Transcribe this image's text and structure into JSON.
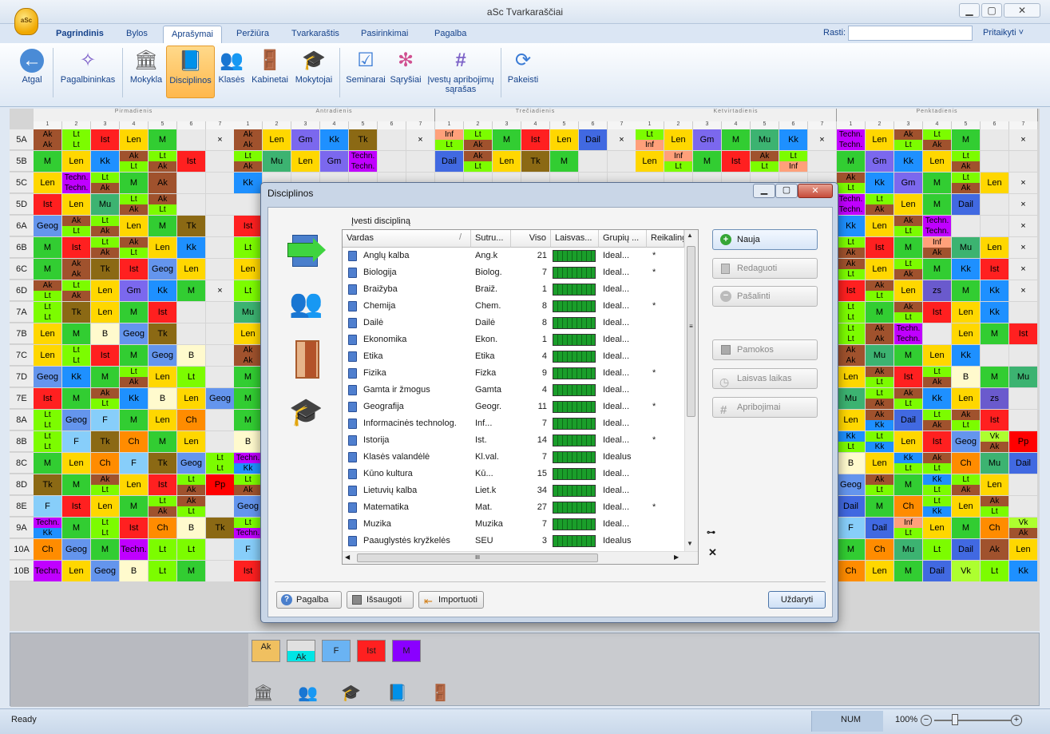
{
  "app": {
    "title": "aSc Tvarkaraščiai",
    "logo_text": "aSc"
  },
  "window_controls": {
    "minimize": "▁",
    "maximize": "▢",
    "close": "✕"
  },
  "menu_tabs": [
    "Pagrindinis",
    "Bylos",
    "Aprašymai",
    "Peržiūra",
    "Tvarkaraštis",
    "Pasirinkimai",
    "Pagalba"
  ],
  "active_tab": "Aprašymai",
  "search": {
    "label": "Rasti:",
    "value": ""
  },
  "customize": "Pritaikyti ˅",
  "ribbon": [
    {
      "label": "Atgal",
      "icon": "back-arrow-icon",
      "glyph": "←"
    },
    {
      "label": "Pagalbininkas",
      "icon": "magic-wand-icon",
      "glyph": "✧"
    },
    {
      "label": "Mokykla",
      "icon": "school-building-icon",
      "glyph": "🏛"
    },
    {
      "label": "Disciplinos",
      "icon": "book-icon",
      "glyph": "📘"
    },
    {
      "label": "Klasės",
      "icon": "students-icon",
      "glyph": "👥"
    },
    {
      "label": "Kabinetai",
      "icon": "door-icon",
      "glyph": "🚪"
    },
    {
      "label": "Mokytojai",
      "icon": "graduation-cap-icon",
      "glyph": "🎓"
    },
    {
      "label": "Seminarai",
      "icon": "seminar-icon",
      "glyph": "☑"
    },
    {
      "label": "Sąryšiai",
      "icon": "relations-icon",
      "glyph": "✻"
    },
    {
      "label": "Įvestų apribojimų sąrašas",
      "icon": "constraints-grid-icon",
      "glyph": "#"
    },
    {
      "label": "Pakeisti",
      "icon": "swap-person-icon",
      "glyph": "⟳"
    }
  ],
  "days": [
    "Pirmadienis",
    "Antradienis",
    "Trečiadienis",
    "Ketvirtadienis",
    "Penktadienis"
  ],
  "periods": [
    "1",
    "2",
    "3",
    "4",
    "5",
    "6",
    "7"
  ],
  "classes": [
    "5A",
    "5B",
    "5C",
    "5D",
    "6A",
    "6B",
    "6C",
    "6D",
    "7A",
    "7B",
    "7C",
    "7D",
    "7E",
    "8A",
    "8B",
    "8C",
    "8D",
    "8E",
    "9A",
    "10A",
    "10B"
  ],
  "timetable": {
    "5A": [
      [
        "Ak|Ak",
        "Lt|Lt",
        "Ist",
        "Len",
        "M",
        "",
        "×"
      ],
      [
        "Ak|Ak",
        "Len",
        "Gm",
        "Kk",
        "Tk",
        "",
        "×"
      ],
      [
        "Inf|Lt",
        "Lt|Ak",
        "M",
        "Ist",
        "Len",
        "Dail",
        "×"
      ],
      [
        "Lt|Inf",
        "Len",
        "Gm",
        "M",
        "Mu",
        "Kk",
        "×"
      ],
      [
        "Techn.|Techn.",
        "Len",
        "Ak|Lt",
        "Lt|Ak",
        "M",
        "",
        "×"
      ]
    ],
    "5B": [
      [
        "M",
        "Len",
        "Kk",
        "Ak|Lt",
        "Lt|Ak",
        "Ist",
        ""
      ],
      [
        "Lt|Ak",
        "Mu",
        "Len",
        "Gm",
        "Techn.|Techn.",
        "",
        ""
      ],
      [
        "Dail",
        "Ak|Lt",
        "Len",
        "Tk",
        "M",
        "",
        ""
      ],
      [
        "Len",
        "Inf|Lt",
        "M",
        "Ist",
        "Ak|Lt",
        "Lt|Inf",
        ""
      ],
      [
        "M",
        "Gm",
        "Kk",
        "Len",
        "Lt|Ak",
        "",
        ""
      ]
    ],
    "5C": [
      [
        "Len",
        "Techn.|Techn.",
        "Lt|Ak",
        "M",
        "Ak",
        "",
        ""
      ],
      [
        "Kk",
        "",
        "",
        "",
        "",
        "",
        ""
      ],
      [
        "",
        "",
        "",
        "",
        "",
        "",
        ""
      ],
      [
        "",
        "",
        "",
        "",
        "",
        "",
        ""
      ],
      [
        "Ak|Lt",
        "Kk",
        "Gm",
        "M",
        "Lt|Ak",
        "Len",
        "×"
      ]
    ],
    "5D": [
      [
        "Ist",
        "Len",
        "Mu",
        "Lt|Ak",
        "Ak|Lt",
        "",
        ""
      ],
      [
        "",
        "",
        "",
        "",
        "",
        "",
        ""
      ],
      [
        "",
        "",
        "",
        "",
        "",
        "",
        ""
      ],
      [
        "",
        "",
        "",
        "",
        "",
        "",
        ""
      ],
      [
        "Techn.|Techn.",
        "Lt|Ak",
        "Len",
        "M",
        "Dail",
        "",
        "×"
      ]
    ],
    "6A": [
      [
        "Geog",
        "Ak|Lt",
        "Lt|Ak",
        "Len",
        "M",
        "Tk",
        ""
      ],
      [
        "Ist",
        "",
        "",
        "",
        "",
        "",
        ""
      ],
      [
        "",
        "",
        "",
        "",
        "",
        "",
        ""
      ],
      [
        "",
        "",
        "",
        "",
        "",
        "",
        ""
      ],
      [
        "Kk",
        "Len",
        "Ak|Lt",
        "Techn.|Techn.",
        "",
        "",
        "×"
      ]
    ],
    "6B": [
      [
        "M",
        "Ist",
        "Lt|Ak",
        "Ak|Lt",
        "Len",
        "Kk",
        ""
      ],
      [
        "Lt",
        "",
        "",
        "",
        "",
        "",
        ""
      ],
      [
        "",
        "",
        "",
        "",
        "",
        "",
        ""
      ],
      [
        "",
        "",
        "",
        "",
        "",
        "",
        ""
      ],
      [
        "Lt|Ak",
        "Ist",
        "M",
        "Inf|Ak",
        "Mu",
        "Len",
        "×"
      ]
    ],
    "6C": [
      [
        "M",
        "Ak|Ak",
        "Tk",
        "Ist",
        "Geog",
        "Len",
        ""
      ],
      [
        "Len",
        "",
        "",
        "",
        "",
        "",
        ""
      ],
      [
        "",
        "",
        "",
        "",
        "",
        "",
        ""
      ],
      [
        "",
        "",
        "",
        "",
        "",
        "",
        ""
      ],
      [
        "Ak|Lt",
        "Len",
        "Lt|Ak",
        "M",
        "Kk",
        "Ist",
        "×"
      ]
    ],
    "6D": [
      [
        "Ak|Lt",
        "Lt|Ak",
        "Len",
        "Gm",
        "Kk",
        "M",
        "×"
      ],
      [
        "Lt",
        "",
        "",
        "",
        "",
        "",
        ""
      ],
      [
        "",
        "",
        "",
        "",
        "",
        "",
        ""
      ],
      [
        "",
        "",
        "",
        "",
        "",
        "",
        ""
      ],
      [
        "Ist",
        "Ak|Lt",
        "Len",
        "zs",
        "M",
        "Kk",
        "×"
      ]
    ],
    "7A": [
      [
        "Lt|Lt",
        "Tk",
        "Len",
        "M",
        "Ist",
        "",
        ""
      ],
      [
        "Mu",
        "",
        "",
        "",
        "",
        "",
        ""
      ],
      [
        "",
        "",
        "",
        "",
        "",
        "",
        ""
      ],
      [
        "",
        "",
        "",
        "",
        "",
        "",
        ""
      ],
      [
        "Lt|Lt",
        "M",
        "Ak|Lt",
        "Ist",
        "Len",
        "Kk",
        ""
      ]
    ],
    "7B": [
      [
        "Len",
        "M",
        "B",
        "Geog",
        "Tk",
        "",
        ""
      ],
      [
        "Len",
        "",
        "",
        "",
        "",
        "",
        ""
      ],
      [
        "",
        "",
        "",
        "",
        "",
        "",
        ""
      ],
      [
        "",
        "",
        "",
        "",
        "",
        "",
        ""
      ],
      [
        "Lt|Lt",
        "Ak|Ak",
        "Techn.|Techn.",
        "",
        "Len",
        "M",
        "Ist"
      ]
    ],
    "7C": [
      [
        "Len",
        "Lt|Lt",
        "Ist",
        "M",
        "Geog",
        "B",
        ""
      ],
      [
        "Ak|Ak",
        "",
        "",
        "",
        "",
        "",
        ""
      ],
      [
        "",
        "",
        "",
        "",
        "",
        "",
        ""
      ],
      [
        "",
        "",
        "",
        "",
        "",
        "",
        ""
      ],
      [
        "Ak|Ak",
        "Mu",
        "M",
        "Len",
        "Kk",
        "",
        ""
      ]
    ],
    "7D": [
      [
        "Geog",
        "Kk",
        "M",
        "Lt|Ak",
        "Len",
        "Lt",
        ""
      ],
      [
        "M",
        "",
        "",
        "",
        "",
        "",
        ""
      ],
      [
        "",
        "",
        "",
        "",
        "",
        "",
        ""
      ],
      [
        "",
        "",
        "",
        "",
        "",
        "",
        ""
      ],
      [
        "Len",
        "Ak|Lt",
        "Ist",
        "Lt|Ak",
        "B",
        "M",
        "Mu"
      ]
    ],
    "7E": [
      [
        "Ist",
        "M",
        "Ak|Lt",
        "Kk",
        "B",
        "Len",
        "Geog"
      ],
      [
        "M",
        "",
        "",
        "",
        "",
        "",
        ""
      ],
      [
        "",
        "",
        "",
        "",
        "",
        "",
        ""
      ],
      [
        "",
        "",
        "",
        "",
        "",
        "",
        ""
      ],
      [
        "Mu",
        "Lt|Ak",
        "Ak|Lt",
        "Kk",
        "Len",
        "zs",
        ""
      ]
    ],
    "8A": [
      [
        "Lt|Lt",
        "Geog",
        "F",
        "M",
        "Len",
        "Ch",
        ""
      ],
      [
        "M",
        "",
        "",
        "",
        "",
        "",
        ""
      ],
      [
        "",
        "",
        "",
        "",
        "",
        "",
        ""
      ],
      [
        "",
        "",
        "",
        "",
        "",
        "",
        ""
      ],
      [
        "Len",
        "Ak|Kk",
        "Dail",
        "Lt|Ak",
        "Ak|Lt",
        "Ist",
        ""
      ]
    ],
    "8B": [
      [
        "Lt|Lt",
        "F",
        "Tk",
        "Ch",
        "M",
        "Len",
        ""
      ],
      [
        "B",
        "",
        "",
        "",
        "",
        "",
        ""
      ],
      [
        "",
        "",
        "",
        "",
        "",
        "",
        ""
      ],
      [
        "",
        "",
        "",
        "",
        "",
        "",
        ""
      ],
      [
        "Kk|Lt",
        "Lt|Kk",
        "Len",
        "Ist",
        "Geog",
        "Vk|Ak",
        "Pp"
      ]
    ],
    "8C": [
      [
        "M",
        "Len",
        "Ch",
        "F",
        "Tk",
        "Geog",
        "Lt|Lt"
      ],
      [
        "Techn.|Kk",
        "",
        "",
        "",
        "",
        "",
        ""
      ],
      [
        "",
        "",
        "",
        "",
        "",
        "",
        ""
      ],
      [
        "",
        "",
        "",
        "",
        "",
        "",
        ""
      ],
      [
        "B",
        "Len",
        "Kk|Lt",
        "Ak|Lt",
        "Ch",
        "Mu",
        "Dail"
      ]
    ],
    "8D": [
      [
        "Tk",
        "M",
        "Ak|Lt",
        "Len",
        "Ist",
        "Lt|Ak",
        "Pp"
      ],
      [
        "Lt|Ak",
        "",
        "",
        "",
        "",
        "",
        ""
      ],
      [
        "",
        "",
        "",
        "",
        "",
        "",
        ""
      ],
      [
        "",
        "",
        "",
        "",
        "",
        "",
        ""
      ],
      [
        "Geog",
        "Ak|Lt",
        "M",
        "Kk|Lt",
        "Lt|Ak",
        "Len",
        ""
      ]
    ],
    "8E": [
      [
        "F",
        "Ist",
        "Len",
        "M",
        "Lt|Ak",
        "Ak|Lt",
        ""
      ],
      [
        "Geog",
        "",
        "",
        "",
        "",
        "",
        ""
      ],
      [
        "",
        "",
        "",
        "",
        "",
        "",
        ""
      ],
      [
        "",
        "",
        "",
        "",
        "",
        "",
        ""
      ],
      [
        "Dail",
        "M",
        "Ch",
        "Lt|Kk",
        "Len",
        "Ak|Lt",
        ""
      ]
    ],
    "9A": [
      [
        "Techn.|Kk",
        "M",
        "Lt|Lt",
        "Ist",
        "Ch",
        "B",
        "Tk"
      ],
      [
        "Lt|Techn.",
        "",
        "",
        "",
        "",
        "",
        ""
      ],
      [
        "",
        "",
        "",
        "",
        "",
        "",
        ""
      ],
      [
        "",
        "",
        "",
        "",
        "",
        "",
        ""
      ],
      [
        "F",
        "Dail",
        "Inf|Lt",
        "Len",
        "M",
        "Ch",
        "Vk|Ak"
      ]
    ],
    "10A": [
      [
        "Ch",
        "Geog",
        "M",
        "Techn.",
        "Lt",
        "Lt",
        ""
      ],
      [
        "F",
        "",
        "",
        "",
        "",
        "",
        ""
      ],
      [
        "",
        "",
        "",
        "",
        "",
        "",
        ""
      ],
      [
        "",
        "",
        "",
        "",
        "",
        "",
        ""
      ],
      [
        "M",
        "Ch",
        "Mu",
        "Lt",
        "Dail",
        "Ak",
        "Len"
      ]
    ],
    "10B": [
      [
        "Techn.",
        "Len",
        "Geog",
        "B",
        "Lt",
        "M",
        ""
      ],
      [
        "Ist",
        "",
        "",
        "",
        "",
        "",
        ""
      ],
      [
        "",
        "",
        "",
        "",
        "",
        "",
        ""
      ],
      [
        "",
        "",
        "",
        "",
        "",
        "",
        ""
      ],
      [
        "Ch",
        "Len",
        "M",
        "Dail",
        "Vk",
        "Lt",
        "Kk"
      ]
    ]
  },
  "subject_colors": {
    "Ak": "#a0522d",
    "Lt": "#7cfc00",
    "Ist": "#ff2020",
    "Len": "#ffd700",
    "M": "#32cd32",
    "Gm": "#7b68ee",
    "Kk": "#1e90ff",
    "Tk": "#8b6914",
    "Inf": "#ffa07a",
    "Dail": "#4169e1",
    "Mu": "#3cb371",
    "Techn.": "#c000ff",
    "Geog": "#6495ed",
    "B": "#fffacd",
    "F": "#87cefa",
    "Ch": "#ff8c00",
    "Pp": "#ff0000",
    "Vk": "#adff2f",
    "zs": "#6a5acd",
    "×": "#ececec",
    "": "#e9e9e9"
  },
  "bottom_cards": [
    [
      "Ak",
      "#f0c060"
    ],
    [
      "Ak",
      "#00e5e5"
    ],
    [
      "F",
      "#6ab3f3"
    ],
    [
      "Ist",
      "#ff2020"
    ],
    [
      "M",
      "#8a00ff"
    ]
  ],
  "bottom_icons": [
    "school-building-icon",
    "students-icon",
    "graduation-cap-icon",
    "book-icon",
    "door-icon"
  ],
  "dialog": {
    "title": "Disciplinos",
    "list_caption": "Įvesti discipliną",
    "columns": [
      "Vardas",
      "Sutru...",
      "Viso",
      "Laisvas...",
      "Grupių ...",
      "Reikaling"
    ],
    "rows": [
      [
        "Anglų kalba",
        "Ang.k",
        "21",
        "Ideal...",
        "*"
      ],
      [
        "Biologija",
        "Biolog.",
        "7",
        "Ideal...",
        "*"
      ],
      [
        "Braižyba",
        "Braiž.",
        "1",
        "Ideal...",
        ""
      ],
      [
        "Chemija",
        "Chem.",
        "8",
        "Ideal...",
        "*"
      ],
      [
        "Dailė",
        "Dailė",
        "8",
        "Ideal...",
        ""
      ],
      [
        "Ekonomika",
        "Ekon.",
        "1",
        "Ideal...",
        ""
      ],
      [
        "Etika",
        "Etika",
        "4",
        "Ideal...",
        ""
      ],
      [
        "Fizika",
        "Fizka",
        "9",
        "Ideal...",
        "*"
      ],
      [
        "Gamta ir žmogus",
        "Gamta",
        "4",
        "Ideal...",
        ""
      ],
      [
        "Geografija",
        "Geogr.",
        "11",
        "Ideal...",
        "*"
      ],
      [
        "Informacinės technolog.",
        "Inf...",
        "7",
        "Ideal...",
        ""
      ],
      [
        "Istorija",
        "Ist.",
        "14",
        "Ideal...",
        "*"
      ],
      [
        "Klasės valandėlė",
        "Kl.val.",
        "7",
        "Idealus",
        ""
      ],
      [
        "Kūno kultura",
        "Kū...",
        "15",
        "Ideal...",
        ""
      ],
      [
        "Lietuvių kalba",
        "Liet.k",
        "34",
        "Ideal...",
        ""
      ],
      [
        "Matematika",
        "Mat.",
        "27",
        "Ideal...",
        "*"
      ],
      [
        "Muzika",
        "Muzika",
        "7",
        "Ideal...",
        ""
      ],
      [
        "Paauglystės kryžkelės",
        "SEU",
        "3",
        "Idealus",
        ""
      ]
    ],
    "buttons": {
      "new": "Nauja",
      "edit": "Redaguoti",
      "delete": "Pašalinti",
      "lessons": "Pamokos",
      "free_time": "Laisvas laikas",
      "constraints": "Apribojimai"
    },
    "footer": {
      "help": "Pagalba",
      "save": "Išsaugoti",
      "import": "Importuoti",
      "close": "Uždaryti"
    },
    "scroll_thumb": "≡",
    "hscroll": "III",
    "key_symbol": "⊶",
    "close_x": "✕"
  },
  "status": {
    "ready": "Ready",
    "num": "NUM",
    "zoom": "100%"
  }
}
